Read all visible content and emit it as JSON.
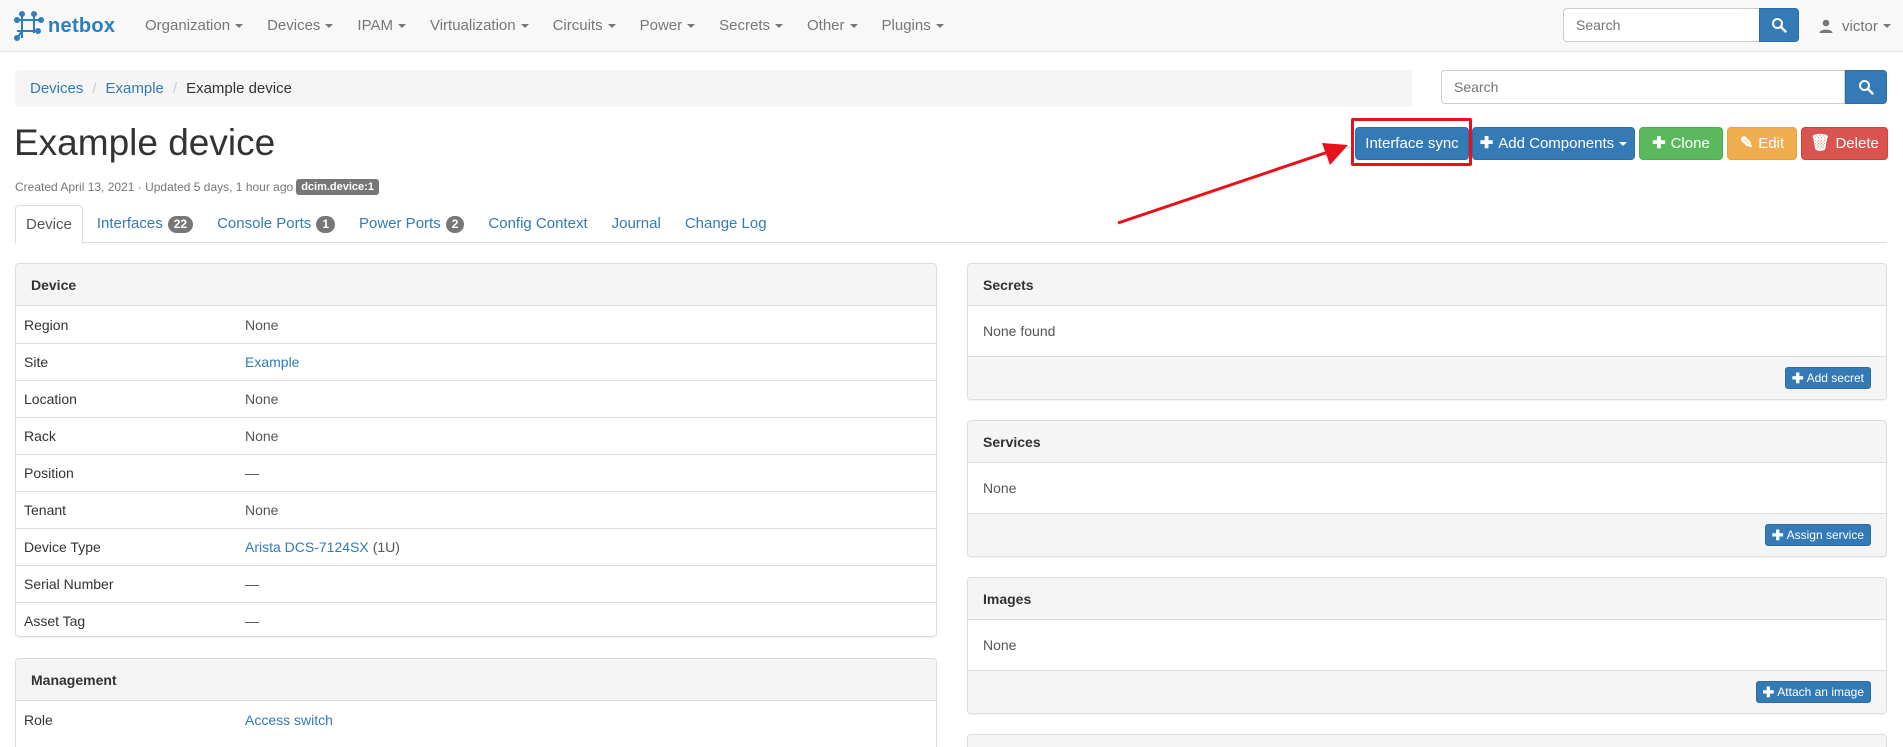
{
  "navbar": {
    "brand": "netbox",
    "menu": [
      "Organization",
      "Devices",
      "IPAM",
      "Virtualization",
      "Circuits",
      "Power",
      "Secrets",
      "Other",
      "Plugins"
    ],
    "search_placeholder": "Search",
    "user": "victor"
  },
  "breadcrumb": [
    "Devices",
    "Example",
    "Example device"
  ],
  "page_search_placeholder": "Search",
  "title": "Example device",
  "meta": {
    "created": "Created April 13, 2021 · Updated 5 days, 1 hour ago",
    "tag": "dcim.device:1"
  },
  "actions": {
    "interface_sync": "Interface sync",
    "add_components": "Add Components",
    "clone": "Clone",
    "edit": "Edit",
    "delete": "Delete"
  },
  "tabs": [
    {
      "label": "Device",
      "badge": ""
    },
    {
      "label": "Interfaces",
      "badge": "22"
    },
    {
      "label": "Console Ports",
      "badge": "1"
    },
    {
      "label": "Power Ports",
      "badge": "2"
    },
    {
      "label": "Config Context",
      "badge": ""
    },
    {
      "label": "Journal",
      "badge": ""
    },
    {
      "label": "Change Log",
      "badge": ""
    }
  ],
  "device_panel": {
    "heading": "Device",
    "rows": [
      {
        "key": "Region",
        "value": "None",
        "link": false
      },
      {
        "key": "Site",
        "value": "Example",
        "link": true
      },
      {
        "key": "Location",
        "value": "None",
        "link": false
      },
      {
        "key": "Rack",
        "value": "None",
        "link": false
      },
      {
        "key": "Position",
        "value": "—",
        "link": false
      },
      {
        "key": "Tenant",
        "value": "None",
        "link": false
      },
      {
        "key": "Device Type",
        "value": "Arista DCS-7124SX",
        "suffix": "(1U)",
        "link": true
      },
      {
        "key": "Serial Number",
        "value": "—",
        "link": false
      },
      {
        "key": "Asset Tag",
        "value": "—",
        "link": false
      }
    ]
  },
  "management_panel": {
    "heading": "Management",
    "rows": [
      {
        "key": "Role",
        "value": "Access switch",
        "link": true
      }
    ]
  },
  "secrets_panel": {
    "heading": "Secrets",
    "body": "None found",
    "button": "Add secret"
  },
  "services_panel": {
    "heading": "Services",
    "body": "None",
    "button": "Assign service"
  },
  "images_panel": {
    "heading": "Images",
    "body": "None",
    "button": "Attach an image"
  },
  "colors": {
    "primary": "#337ab7",
    "success": "#5cb85c",
    "warning": "#f0ad4e",
    "danger": "#d9534f",
    "highlight": "#e8101a"
  }
}
